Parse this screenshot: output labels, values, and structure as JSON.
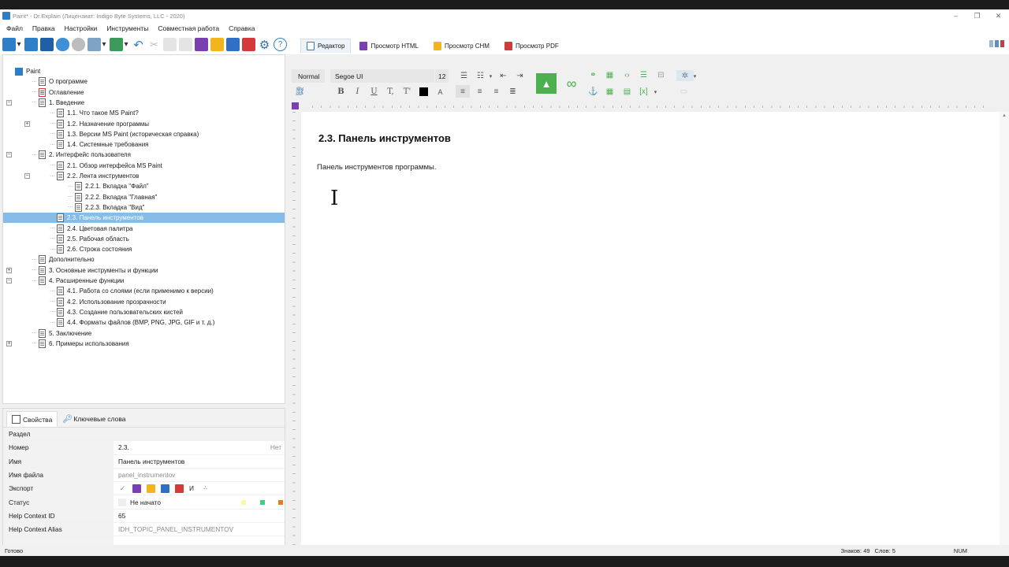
{
  "window": {
    "title": "Paint* - Dr.Explain (Лицензиат: Indigo Byte Systems, LLC - 2020)"
  },
  "menu": [
    "Файл",
    "Правка",
    "Настройки",
    "Инструменты",
    "Совместная работа",
    "Справка"
  ],
  "view_tabs": [
    {
      "label": "Редактор",
      "active": true,
      "color": "#2f7fc8"
    },
    {
      "label": "Просмотр HTML",
      "active": false,
      "color": "#7a3fb0"
    },
    {
      "label": "Просмотр CHM",
      "active": false,
      "color": "#f2b51e"
    },
    {
      "label": "Просмотр PDF",
      "active": false,
      "color": "#d33a3a"
    }
  ],
  "formatting": {
    "style": "Normal",
    "font": "Segoe UI",
    "size": "12"
  },
  "tree": [
    {
      "label": "Paint",
      "depth": 0,
      "expander": "",
      "icon": "project",
      "selected": false
    },
    {
      "label": "О программе",
      "depth": 1,
      "expander": "",
      "icon": "page",
      "selected": false
    },
    {
      "label": "Оглавление",
      "depth": 1,
      "expander": "",
      "icon": "toc",
      "selected": false
    },
    {
      "label": "1. Введение",
      "depth": 1,
      "expander": "−",
      "icon": "page",
      "selected": false
    },
    {
      "label": "1.1. Что такое MS Paint?",
      "depth": 2,
      "expander": "",
      "icon": "page",
      "selected": false
    },
    {
      "label": "1.2. Назначение программы",
      "depth": 2,
      "expander": "+",
      "icon": "page",
      "selected": false
    },
    {
      "label": "1.3. Версии MS Paint (историческая справка)",
      "depth": 2,
      "expander": "",
      "icon": "page",
      "selected": false
    },
    {
      "label": "1.4. Системные требования",
      "depth": 2,
      "expander": "",
      "icon": "page",
      "selected": false
    },
    {
      "label": "2. Интерфейс пользователя",
      "depth": 1,
      "expander": "−",
      "icon": "page",
      "selected": false
    },
    {
      "label": "2.1. Обзор интерфейса MS Paint",
      "depth": 2,
      "expander": "",
      "icon": "page",
      "selected": false
    },
    {
      "label": "2.2. Лента инструментов",
      "depth": 2,
      "expander": "−",
      "icon": "page",
      "selected": false
    },
    {
      "label": "2.2.1. Вкладка \"Файл\"",
      "depth": 3,
      "expander": "",
      "icon": "page",
      "selected": false
    },
    {
      "label": "2.2.2. Вкладка \"Главная\"",
      "depth": 3,
      "expander": "",
      "icon": "page",
      "selected": false
    },
    {
      "label": "2.2.3. Вкладка \"Вид\"",
      "depth": 3,
      "expander": "",
      "icon": "page",
      "selected": false
    },
    {
      "label": "2.3. Панель инструментов",
      "depth": 2,
      "expander": "",
      "icon": "page",
      "selected": true
    },
    {
      "label": "2.4. Цветовая палитра",
      "depth": 2,
      "expander": "",
      "icon": "page",
      "selected": false
    },
    {
      "label": "2.5. Рабочая область",
      "depth": 2,
      "expander": "",
      "icon": "page",
      "selected": false
    },
    {
      "label": "2.6. Строка состояния",
      "depth": 2,
      "expander": "",
      "icon": "page",
      "selected": false
    },
    {
      "label": "Дополнительно",
      "depth": 1,
      "expander": "",
      "icon": "page",
      "selected": false
    },
    {
      "label": "3. Основные инструменты и функции",
      "depth": 1,
      "expander": "+",
      "icon": "page",
      "selected": false
    },
    {
      "label": "4. Расширенные функции",
      "depth": 1,
      "expander": "−",
      "icon": "page",
      "selected": false
    },
    {
      "label": "4.1. Работа со слоями (если применимо к версии)",
      "depth": 2,
      "expander": "",
      "icon": "page",
      "selected": false
    },
    {
      "label": "4.2. Использование прозрачности",
      "depth": 2,
      "expander": "",
      "icon": "page",
      "selected": false
    },
    {
      "label": "4.3. Создание пользовательских кистей",
      "depth": 2,
      "expander": "",
      "icon": "page",
      "selected": false
    },
    {
      "label": "4.4. Форматы файлов (BMP, PNG, JPG, GIF и т. д.)",
      "depth": 2,
      "expander": "",
      "icon": "page",
      "selected": false
    },
    {
      "label": "5. Заключение",
      "depth": 1,
      "expander": "",
      "icon": "page",
      "selected": false
    },
    {
      "label": "6. Примеры использования",
      "depth": 1,
      "expander": "+",
      "icon": "page",
      "selected": false
    }
  ],
  "props": {
    "tabs": [
      "Свойства",
      "Ключевые слова"
    ],
    "section": "Раздел",
    "number_label": "Номер",
    "number_value": "2.3.",
    "number_extra": "Нет",
    "name_label": "Имя",
    "name_value": "Панель инструментов",
    "file_label": "Имя файла",
    "file_value": "panel_instrumentov",
    "export_label": "Экспорт",
    "export_text": "И",
    "status_label": "Статус",
    "status_value": "Не начато",
    "hcid_label": "Help Context ID",
    "hcid_value": "65",
    "hca_label": "Help Context Alias",
    "hca_value": "IDH_TOPIC_PANEL_INSTRUMENTOV"
  },
  "document": {
    "heading": "2.3. Панель инструментов",
    "body": "Панель инструментов программы."
  },
  "status": {
    "left": "Готово",
    "chars": "Знаков: 49",
    "words": "Слов: 5",
    "num": "NUM"
  }
}
